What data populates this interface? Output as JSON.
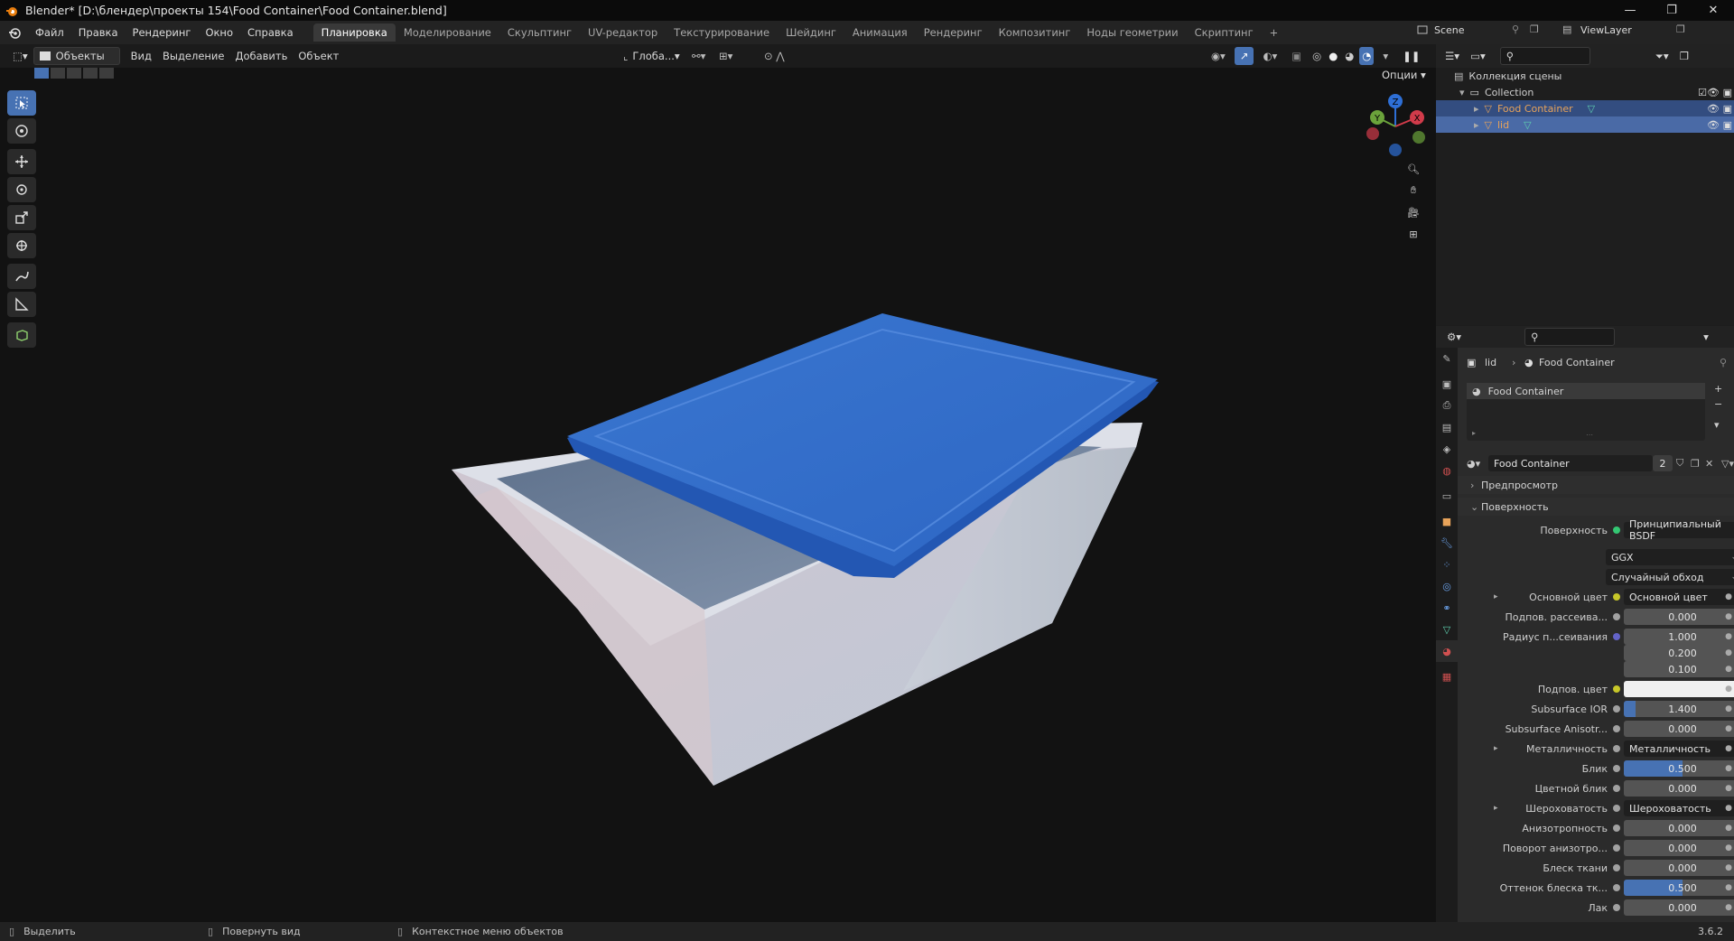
{
  "window": {
    "title": "Blender* [D:\\блендер\\проекты 154\\Food Container\\Food Container.blend]",
    "controls": [
      "—",
      "❐",
      "✕"
    ]
  },
  "menu": [
    "Файл",
    "Правка",
    "Рендеринг",
    "Окно",
    "Справка"
  ],
  "workspaces": [
    "Планировка",
    "Моделирование",
    "Скульптинг",
    "UV-редактор",
    "Текстурирование",
    "Шейдинг",
    "Анимация",
    "Рендеринг",
    "Композитинг",
    "Ноды геометрии",
    "Скриптинг"
  ],
  "active_workspace": "Планировка",
  "scene": {
    "name": "Scene",
    "view_layer": "ViewLayer"
  },
  "viewport_header": {
    "mode": "Объекты",
    "menus": [
      "Вид",
      "Выделение",
      "Добавить",
      "Объект"
    ],
    "orientation": "Глоба...",
    "options": "Опции"
  },
  "outliner": {
    "scene_collection": "Коллекция сцены",
    "collection": "Collection",
    "items": [
      {
        "name": "Food Container",
        "color": "#e8a35a"
      },
      {
        "name": "lid",
        "color": "#e8a35a"
      }
    ]
  },
  "properties": {
    "breadcrumb": [
      "lid",
      "Food Container"
    ],
    "material_slot": "Food Container",
    "material_name": "Food Container",
    "users": "2",
    "panel_preview": "Предпросмотр",
    "panel_surface": "Поверхность",
    "surface_label": "Поверхность",
    "surface_value": "Принципиальный BSDF",
    "distribution": "GGX",
    "subsurface_method": "Случайный обход",
    "rows": [
      {
        "label": "Основной цвет",
        "value": "Основной цвет",
        "kind": "link",
        "dot": "#c7c729",
        "expand": true
      },
      {
        "label": "Подпов. рассеива...",
        "value": "0.000",
        "kind": "num",
        "dot": "#a1a1a1"
      },
      {
        "label": "Радиус п...сеивания",
        "value": "1.000",
        "kind": "num",
        "dot": "#6363c7"
      },
      {
        "label": "",
        "value": "0.200",
        "kind": "num",
        "dot": ""
      },
      {
        "label": "",
        "value": "0.100",
        "kind": "num",
        "dot": ""
      },
      {
        "label": "Подпов. цвет",
        "value": "",
        "kind": "color",
        "dot": "#c7c729"
      },
      {
        "label": "Subsurface IOR",
        "value": "1.400",
        "kind": "num",
        "dot": "#a1a1a1",
        "fill": 0.1
      },
      {
        "label": "Subsurface Anisotr...",
        "value": "0.000",
        "kind": "num",
        "dot": "#a1a1a1"
      },
      {
        "label": "Металличность",
        "value": "Металличность",
        "kind": "link",
        "dot": "#a1a1a1",
        "expand": true
      },
      {
        "label": "Блик",
        "value": "0.500",
        "kind": "num",
        "dot": "#a1a1a1",
        "fill": 0.5
      },
      {
        "label": "Цветной блик",
        "value": "0.000",
        "kind": "num",
        "dot": "#a1a1a1"
      },
      {
        "label": "Шероховатость",
        "value": "Шероховатость",
        "kind": "link",
        "dot": "#a1a1a1",
        "expand": true
      },
      {
        "label": "Анизотропность",
        "value": "0.000",
        "kind": "num",
        "dot": "#a1a1a1"
      },
      {
        "label": "Поворот анизотро...",
        "value": "0.000",
        "kind": "num",
        "dot": "#a1a1a1"
      },
      {
        "label": "Блеск ткани",
        "value": "0.000",
        "kind": "num",
        "dot": "#a1a1a1"
      },
      {
        "label": "Оттенок блеска тк...",
        "value": "0.500",
        "kind": "num",
        "dot": "#a1a1a1",
        "fill": 0.5
      },
      {
        "label": "Лак",
        "value": "0.000",
        "kind": "num",
        "dot": "#a1a1a1"
      }
    ]
  },
  "statusbar": {
    "select": "Выделить",
    "rotate": "Повернуть вид",
    "context": "Контекстное меню объектов",
    "version": "3.6.2"
  },
  "gizmo": {
    "x": "X",
    "y": "Y",
    "z": "Z"
  },
  "colors": {
    "accent": "#4772b3",
    "lid": "#2f6fd1",
    "container": "#d9dde6"
  }
}
